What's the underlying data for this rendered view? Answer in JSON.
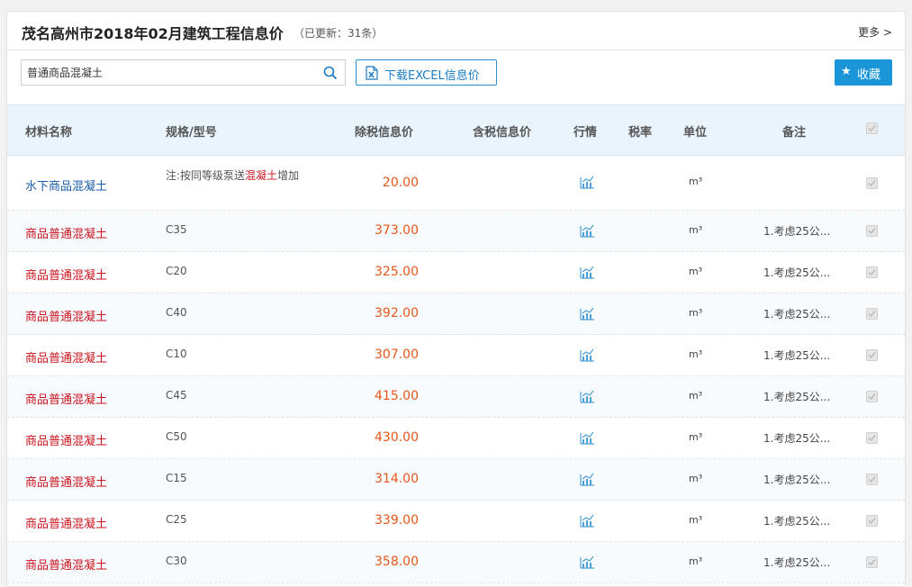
{
  "header": {
    "title": "茂名高州市2018年02月建筑工程信息价",
    "updated": "（已更新：31条）",
    "more": "更多 >"
  },
  "toolbar": {
    "search_value": "普通商品混凝土",
    "download_label": "下载EXCEL信息价",
    "favorite_label": "收藏"
  },
  "table": {
    "columns": {
      "name": "材料名称",
      "spec": "规格/型号",
      "price_ex_tax": "除税信息价",
      "price_inc_tax": "含税信息价",
      "trend": "行情",
      "tax_rate": "税率",
      "unit": "单位",
      "remark": "备注"
    },
    "rows": [
      {
        "name": "水下商品混凝土",
        "spec_pre": "注:按同等级泵送",
        "spec_hl": "混凝土",
        "spec_post": "增加",
        "price": "20.00",
        "unit": "m³",
        "remark": ""
      },
      {
        "name": "商品普通混凝土",
        "spec": "C35",
        "price": "373.00",
        "unit": "m³",
        "remark": "1.考虑25公..."
      },
      {
        "name": "商品普通混凝土",
        "spec": "C20",
        "price": "325.00",
        "unit": "m³",
        "remark": "1.考虑25公..."
      },
      {
        "name": "商品普通混凝土",
        "spec": "C40",
        "price": "392.00",
        "unit": "m³",
        "remark": "1.考虑25公..."
      },
      {
        "name": "商品普通混凝土",
        "spec": "C10",
        "price": "307.00",
        "unit": "m³",
        "remark": "1.考虑25公..."
      },
      {
        "name": "商品普通混凝土",
        "spec": "C45",
        "price": "415.00",
        "unit": "m³",
        "remark": "1.考虑25公..."
      },
      {
        "name": "商品普通混凝土",
        "spec": "C50",
        "price": "430.00",
        "unit": "m³",
        "remark": "1.考虑25公..."
      },
      {
        "name": "商品普通混凝土",
        "spec": "C15",
        "price": "314.00",
        "unit": "m³",
        "remark": "1.考虑25公..."
      },
      {
        "name": "商品普通混凝土",
        "spec": "C25",
        "price": "339.00",
        "unit": "m³",
        "remark": "1.考虑25公..."
      },
      {
        "name": "商品普通混凝土",
        "spec": "C30",
        "price": "358.00",
        "unit": "m³",
        "remark": "1.考虑25公..."
      }
    ]
  },
  "colors": {
    "accent": "#1a96d8",
    "price": "#e8571a",
    "name_red": "#c9151e",
    "name_blue": "#1a5ea8",
    "header_bg": "#eaf4fc"
  },
  "icons": [
    "search-icon",
    "excel-icon",
    "star-icon",
    "trend-chart-icon",
    "check-icon"
  ]
}
